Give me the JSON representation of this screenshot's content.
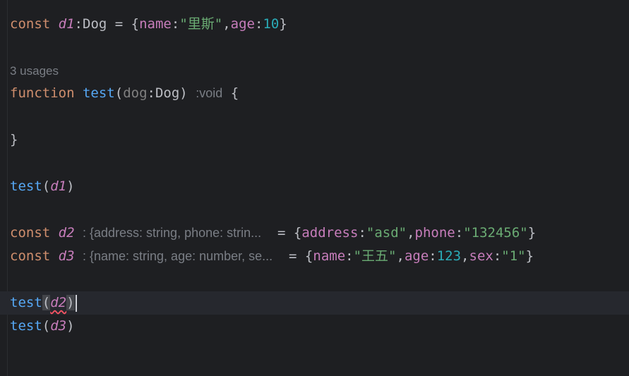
{
  "editor": {
    "line1": {
      "kw": "const",
      "var": "d1",
      "colon": ":",
      "type": "Dog",
      "eq_open": " = {",
      "p1": "name",
      "c1": ":",
      "s1": "\"里斯\"",
      "comma": ",",
      "p2": "age",
      "c2": ":",
      "n1": "10",
      "close": "}"
    },
    "usages": "3 usages",
    "line2": {
      "kw": "function",
      "fn": "test",
      "open": "(",
      "param": "dog",
      "colon": ":",
      "type": "Dog",
      "close": ")",
      "hint": ":void",
      "brace": "{"
    },
    "line3": {
      "brace": "}"
    },
    "line4": {
      "fn": "test",
      "open": "(",
      "arg": "d1",
      "close": ")"
    },
    "line5": {
      "kw": "const",
      "var": "d2",
      "hint": ": {address: string, phone: strin...",
      "eq_open": "= {",
      "p1": "address",
      "c1": ":",
      "s1": "\"asd\"",
      "comma": ",",
      "p2": "phone",
      "c2": ":",
      "s2": "\"132456\"",
      "close": "}"
    },
    "line6": {
      "kw": "const",
      "var": "d3",
      "hint": ": {name: string, age: number, se...",
      "eq_open": "= {",
      "p1": "name",
      "c1": ":",
      "s1": "\"王五\"",
      "comma1": ",",
      "p2": "age",
      "c2": ":",
      "n1": "123",
      "comma2": ",",
      "p3": "sex",
      "c3": ":",
      "s3": "\"1\"",
      "close": "}"
    },
    "line7": {
      "fn": "test",
      "open": "(",
      "arg": "d2",
      "close": ")"
    },
    "line8": {
      "fn": "test",
      "open": "(",
      "arg": "d3",
      "close": ")"
    }
  }
}
